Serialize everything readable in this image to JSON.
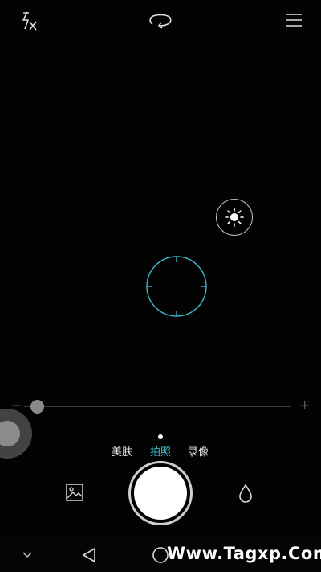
{
  "top_bar": {
    "flash_icon": "flash-auto-icon",
    "switch_camera_icon": "switch-camera-icon",
    "menu_icon": "menu-icon"
  },
  "viewfinder": {
    "focus_icon": "focus-ring-icon",
    "exposure_icon": "sun-icon"
  },
  "zoom": {
    "minus_label": "−",
    "plus_label": "+",
    "level": 0.05
  },
  "modes": {
    "items": [
      {
        "label": "美肤",
        "active": false
      },
      {
        "label": "拍照",
        "active": true
      },
      {
        "label": "录像",
        "active": false
      }
    ]
  },
  "bottom_controls": {
    "gallery_icon": "gallery-icon",
    "shutter_icon": "shutter-button",
    "filter_icon": "water-drop-icon"
  },
  "navbar": {
    "down_icon": "chevron-down-icon",
    "back_icon": "back-triangle-icon",
    "home_icon": "home-circle-icon"
  },
  "watermark": {
    "text": "Www.Tagxp.Com"
  },
  "colors": {
    "accent": "#3fb8c9",
    "background": "#030303",
    "text": "#e8e8e8"
  }
}
